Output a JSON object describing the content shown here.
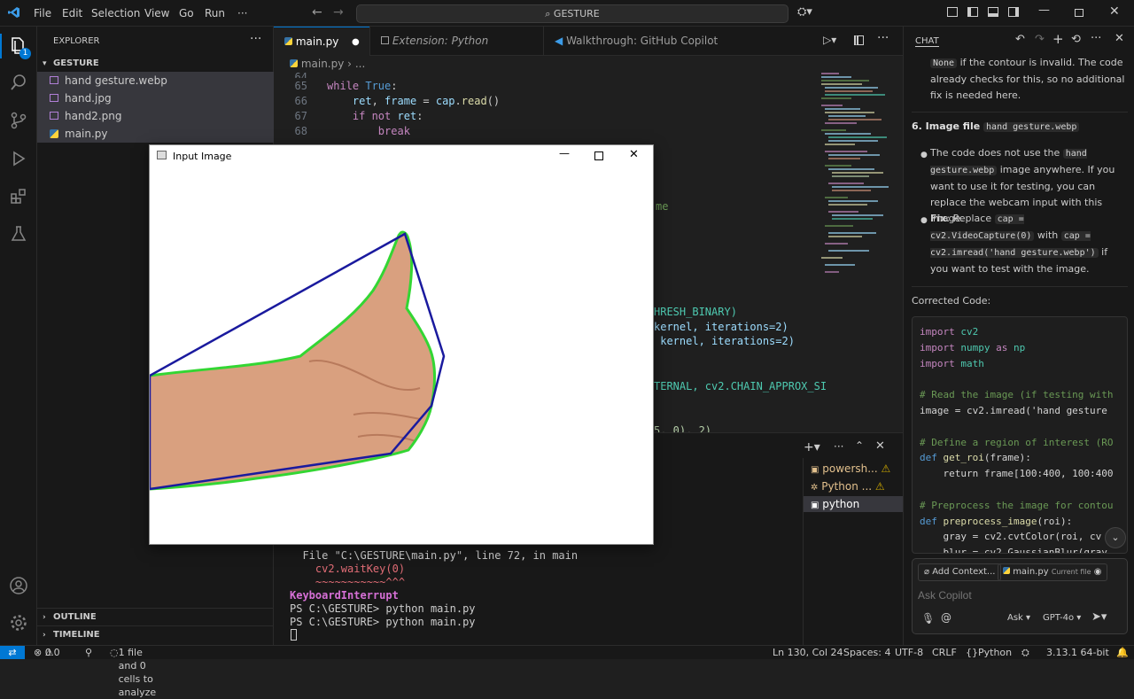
{
  "titlebar": {
    "menus": [
      "File",
      "Edit",
      "Selection",
      "View",
      "Go",
      "Run",
      "···"
    ],
    "search": "GESTURE"
  },
  "sidebar": {
    "header": "EXPLORER",
    "folder": "GESTURE",
    "files": [
      "hand gesture.webp",
      "hand.jpg",
      "hand2.png",
      "main.py"
    ],
    "outline": "OUTLINE",
    "timeline": "TIMELINE"
  },
  "tabs": [
    {
      "label": "main.py"
    },
    {
      "label": "Extension: Python Debugger"
    },
    {
      "label": "Walkthrough: GitHub Copilot Chat"
    }
  ],
  "breadcrumb": {
    "file": "main.py",
    "sep": "›",
    "more": "..."
  },
  "editor": {
    "lines": [
      {
        "n": "64",
        "code": ""
      },
      {
        "n": "65",
        "code": "while True:"
      },
      {
        "n": "66",
        "code": "    ret, frame = cap.read()"
      },
      {
        "n": "67",
        "code": "    if not ret:"
      },
      {
        "n": "68",
        "code": "        break"
      }
    ],
    "peek": {
      "me": "me",
      "thresh": "HRESH_BINARY)",
      "kernel1": "kernel, iterations=2)",
      "kernel2": " kernel, iterations=2)",
      "chain": "TERNAL, cv2.CHAIN_APPROX_SI",
      "last": "5, 0), 2)"
    }
  },
  "terminal": {
    "lines": [
      "  File \"C:\\GESTURE\\main.py\", line 72, in main",
      "    cv2.waitKey(0)",
      "    ~~~~~~~~~~~^^^",
      "KeyboardInterrupt",
      "PS C:\\GESTURE> python main.py",
      "PS C:\\GESTURE> python main.py"
    ],
    "sessions": [
      "powersh...",
      "Python ...",
      "python"
    ]
  },
  "image_window": {
    "title": "Input Image"
  },
  "chat": {
    "header": "CHAT",
    "p1_code": "None",
    "p1_text": " if the contour is invalid. The code already checks for this, so no additional fix is needed here.",
    "h6_prefix": "6. Image file ",
    "h6_code": "hand gesture.webp",
    "b1_text_a": "The code does not use the ",
    "b1_code": "hand gesture.webp",
    "b1_text_b": " image anywhere. If you want to use it for testing, you can replace the webcam input with this image.",
    "b2_fix": "Fix",
    "b2_text_a": ": Replace ",
    "b2_code1": "cap = cv2.VideoCapture(0)",
    "b2_text_b": " with ",
    "b2_code2": "cap = cv2.imread('hand gesture.webp')",
    "b2_text_c": " if you want to test with the image.",
    "corrected": "Corrected Code:",
    "code": [
      {
        "t": "import cv2",
        "k": "import"
      },
      {
        "t": "import numpy as np",
        "k": "import"
      },
      {
        "t": "import math",
        "k": "import"
      },
      {
        "t": "",
        "k": ""
      },
      {
        "t": "# Read the image (if testing with",
        "k": "comment"
      },
      {
        "t": "image = cv2.imread('hand gesture",
        "k": "plain"
      },
      {
        "t": "",
        "k": ""
      },
      {
        "t": "# Define a region of interest (RO",
        "k": "comment"
      },
      {
        "t": "def get_roi(frame):",
        "k": "def"
      },
      {
        "t": "    return frame[100:400, 100:400",
        "k": "plain"
      },
      {
        "t": "",
        "k": ""
      },
      {
        "t": "# Preprocess the image for contou",
        "k": "comment"
      },
      {
        "t": "def preprocess_image(roi):",
        "k": "def"
      },
      {
        "t": "    gray = cv2.cvtColor(roi, cv",
        "k": "plain"
      },
      {
        "t": "    blur = cv2.GaussianBlur(gray",
        "k": "plain"
      }
    ],
    "add_context": "Add Context...",
    "ctx_file": "main.py",
    "ctx_note": "Current file",
    "placeholder": "Ask Copilot",
    "mode": "Ask",
    "model": "GPT-4o"
  },
  "status": {
    "errors": "0",
    "warnings": "0",
    "analyze": "1 file and 0 cells to analyze",
    "position": "Ln 130, Col 24",
    "spaces": "Spaces: 4",
    "encoding": "UTF-8",
    "eol": "CRLF",
    "language": "Python",
    "version": "3.13.1 64-bit"
  },
  "colors": {
    "accent": "#0078d4",
    "keyword": "#c586c0",
    "func": "#dcdcaa",
    "var": "#9cdcfe",
    "string": "#ce9178",
    "number": "#b5cea8",
    "comment": "#6a9955"
  }
}
